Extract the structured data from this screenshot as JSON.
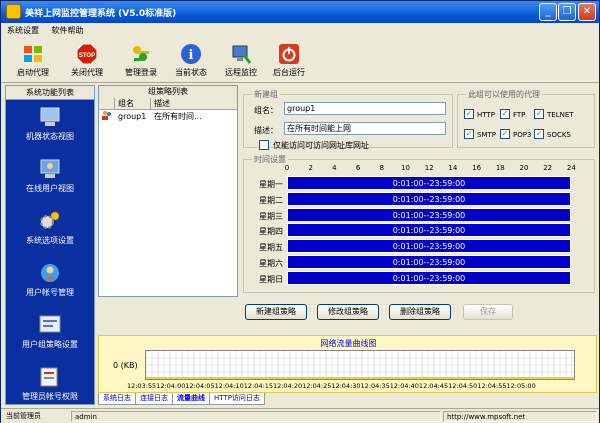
{
  "window": {
    "title": "美祥上网监控管理系统 (V5.0标准版)"
  },
  "menu": [
    "系统设置",
    "软件帮助"
  ],
  "toolbar": [
    {
      "label": "启动代理",
      "icon": "windows-flag-icon"
    },
    {
      "label": "关闭代理",
      "icon": "stop-sign-icon"
    },
    {
      "label": "管理登录",
      "icon": "keys-icon"
    },
    {
      "label": "当前状态",
      "icon": "info-icon"
    },
    {
      "label": "远程监控",
      "icon": "remote-monitor-icon"
    },
    {
      "label": "后台运行",
      "icon": "power-icon"
    }
  ],
  "sidebar": {
    "title": "系统功能列表",
    "items": [
      {
        "label": "机器状态视图",
        "icon": "computer-icon"
      },
      {
        "label": "在线用户视图",
        "icon": "online-user-icon"
      },
      {
        "label": "系统选项设置",
        "icon": "gears-icon"
      },
      {
        "label": "用户帐号管理",
        "icon": "user-account-icon"
      },
      {
        "label": "用户组策略设置",
        "icon": "group-policy-icon"
      },
      {
        "label": "管理员帐号权限",
        "icon": "admin-permission-icon"
      }
    ]
  },
  "group_list": {
    "title": "组策略列表",
    "columns": [
      "组名",
      "描述"
    ],
    "rows": [
      {
        "name": "group1",
        "desc": "在所有时间..."
      }
    ]
  },
  "new_group": {
    "legend": "新建组",
    "name_label": "组名：",
    "name_value": "group1",
    "desc_label": "描述：",
    "desc_value": "在所有时间能上网",
    "only_list_label": "仅能访问可访问网址库网址"
  },
  "proxies": {
    "legend": "此组可以使用的代理",
    "items": [
      "HTTP",
      "FTP",
      "TELNET",
      "SMTP",
      "POP3",
      "SOCKS"
    ]
  },
  "time_settings": {
    "legend": "时间设置",
    "hours": [
      "0",
      "2",
      "4",
      "6",
      "8",
      "10",
      "12",
      "14",
      "16",
      "18",
      "20",
      "22",
      "24"
    ],
    "days": [
      {
        "label": "星期一",
        "range": "0:01:00--23:59:00"
      },
      {
        "label": "星期二",
        "range": "0:01:00--23:59:00"
      },
      {
        "label": "星期三",
        "range": "0:01:00--23:59:00"
      },
      {
        "label": "星期四",
        "range": "0:01:00--23:59:00"
      },
      {
        "label": "星期五",
        "range": "0:01:00--23:59:00"
      },
      {
        "label": "星期六",
        "range": "0:01:00--23:59:00"
      },
      {
        "label": "星期日",
        "range": "0:01:00--23:59:00"
      }
    ]
  },
  "buttons": [
    "新建组策略",
    "修改组策略",
    "删除组策略",
    "保存"
  ],
  "traffic_chart": {
    "title": "网络流量曲线图",
    "ylabel": "0 (KB)",
    "x_ticks": [
      "12:03:55",
      "12:04:00",
      "12:04:05",
      "12:04:10",
      "12:04:15",
      "12:04:20",
      "12:04:25",
      "12:04:30",
      "12:04:35",
      "12:04:40",
      "12:04:45",
      "12:04:50",
      "12:04:55",
      "12:05:00"
    ]
  },
  "tabs": [
    "系统日志",
    "连接日志",
    "流量曲线",
    "HTTP访问日志"
  ],
  "status": {
    "label": "当前管理员",
    "user": "admin",
    "url": "http://www.mpsoft.net"
  }
}
